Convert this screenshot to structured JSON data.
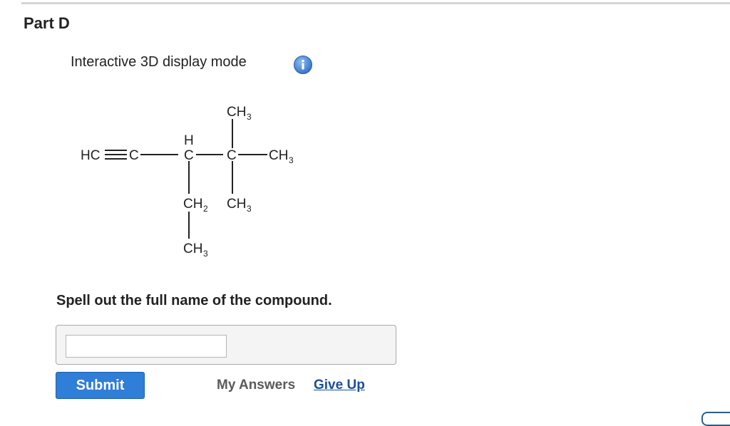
{
  "part": {
    "title": "Part D"
  },
  "display": {
    "mode_label": "Interactive 3D display mode",
    "info_icon": "info-icon"
  },
  "structure": {
    "atoms": {
      "alkyne_ch": "HC",
      "alkyne_c": "C",
      "chiral_c": "C",
      "chiral_h": "H",
      "quat_c": "C",
      "ch2_base": "CH",
      "ch3_base": "CH",
      "sub_2": "2",
      "sub_3": "3"
    }
  },
  "question": {
    "prompt": "Spell out the full name of the compound.",
    "answer_value": "",
    "answer_placeholder": ""
  },
  "actions": {
    "submit_label": "Submit",
    "my_answers_label": "My Answers",
    "give_up_label": "Give Up"
  },
  "colors": {
    "submit_bg": "#2f7ed8",
    "link": "#1a4e97",
    "info_icon": "#3d7fd1"
  }
}
